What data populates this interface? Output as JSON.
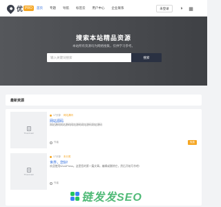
{
  "header": {
    "logo_text": "优",
    "logo_badge": "PRO",
    "nav": [
      "首页",
      "专题",
      "导航",
      "标签云",
      "用户中心",
      "企业联系"
    ],
    "login_label": "未登录",
    "icons": [
      "moon-icon",
      "grid-icon"
    ]
  },
  "hero": {
    "title": "搜索本站精品资源",
    "subtitle": "本站所有资源均为网络搜集，仅供学习参考。",
    "search_placeholder": "输入关键词搜索",
    "search_button": "搜索"
  },
  "section": {
    "title": "最新资源"
  },
  "cards": [
    {
      "time": "17分钟",
      "tag": "网站源码",
      "title": "网站源码",
      "desc": "网站源码网站源码网站源码网站源码网站源码",
      "author": "作者",
      "badge": "免费",
      "thumb_text": "Thumbnail"
    },
    {
      "time": "17分钟",
      "tag": "未分类",
      "title": "世界，您好!",
      "desc": "欢迎使用WordPress。这是您的第一篇文章。编辑或删除它，然后开始写作吧!",
      "author": "作者",
      "badge": "",
      "thumb_text": "Thumbnail"
    }
  ],
  "watermark": {
    "text": "链发发SEO"
  },
  "colors": {
    "accent": "#2d6cdf",
    "badge": "#f5a623",
    "hero_bg": "#4a4c50",
    "search_btn": "#2a3142",
    "watermark": "#16a34a"
  }
}
